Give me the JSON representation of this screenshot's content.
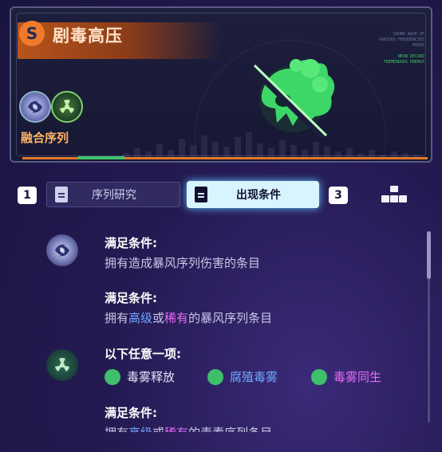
{
  "header": {
    "title": "剧毒高压",
    "title_icon": "S",
    "fusion_label": "融合序列",
    "side_text": [
      "SOUND WAVE OF",
      "VARIOUS FREQUENCIES",
      "HOUSE",
      "",
      "NEON RECORD",
      "TREMENDOUS ENERGY"
    ]
  },
  "tabs": {
    "left_number": "1",
    "tab1_label": "序列研究",
    "tab2_label": "出现条件",
    "right_number": "3"
  },
  "conditions": {
    "block1_title": "满足条件:",
    "block1_text": "拥有造成暴风序列伤害的条目",
    "block2_title": "满足条件:",
    "block2_pre": "拥有",
    "block2_hl1": "高级",
    "block2_mid": "或",
    "block2_hl2": "稀有",
    "block2_post": "的暴风序列条目",
    "block3_title": "以下任意一项:",
    "options": [
      "毒雾释放",
      "腐殖毒雾",
      "毒雾同生"
    ],
    "block4_title": "满足条件:",
    "block4_pre": "拥有",
    "block4_hl1": "高级",
    "block4_mid": "或",
    "block4_hl2": "稀有",
    "block4_post": "的毒素序列条目"
  },
  "colors": {
    "accent_orange": "#e3782a",
    "accent_green": "#3ec46d",
    "highlight_blue": "#6ea8ff",
    "highlight_pink": "#e56cf5",
    "tab_active_bg": "#d8f4ff"
  }
}
